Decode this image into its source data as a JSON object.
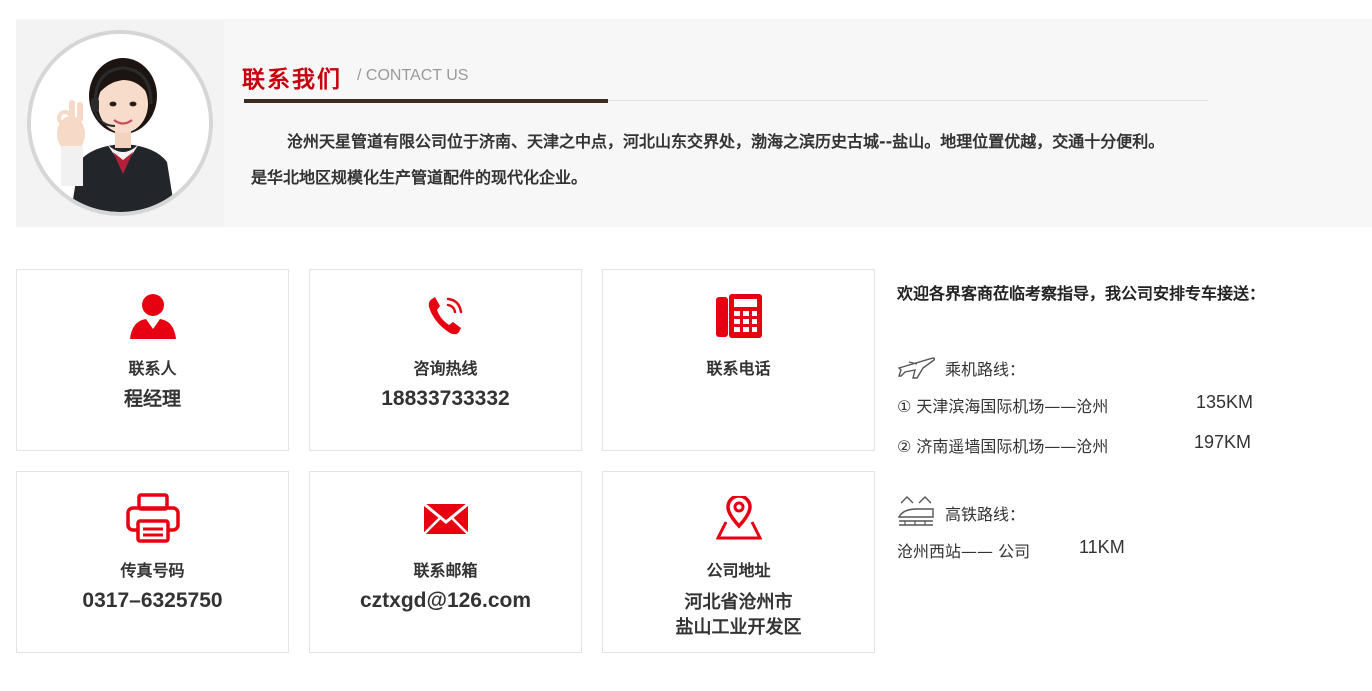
{
  "header": {
    "title_cn": "联系我们",
    "title_en": "/ CONTACT US",
    "intro_line1": "沧州天星管道有限公司位于济南、天津之中点，河北山东交界处，渤海之滨历史古城--盐山。地理位置优越，交通十分便利。",
    "intro_line2": "是华北地区规模化生产管道配件的现代化企业。",
    "avatar_icon": "customer-service-avatar"
  },
  "cards": [
    {
      "icon": "person-icon",
      "label": "联系人",
      "value": "程经理"
    },
    {
      "icon": "phone-call-icon",
      "label": "咨询热线",
      "value": "18833733332"
    },
    {
      "icon": "telephone-icon",
      "label": "联系电话",
      "value": ""
    },
    {
      "icon": "fax-printer-icon",
      "label": "传真号码",
      "value": "0317–6325750"
    },
    {
      "icon": "envelope-icon",
      "label": "联系邮箱",
      "value": "cztxgd@126.com"
    },
    {
      "icon": "map-pin-icon",
      "label": "公司地址",
      "value_line1": "河北省沧州市",
      "value_line2": "盐山工业开发区"
    }
  ],
  "routes": {
    "welcome": "欢迎各界客商莅临考察指导，我公司安排专车接送：",
    "air_heading": "乘机路线：",
    "air": [
      {
        "route": "① 天津滨海国际机场——沧州",
        "distance": "135KM"
      },
      {
        "route": "② 济南遥墙国际机场——沧州",
        "distance": "197KM"
      }
    ],
    "rail_heading": "高铁路线：",
    "rail": [
      {
        "route": "沧州西站—— 公司",
        "distance": "11KM"
      }
    ]
  },
  "colors": {
    "accent": "#e60012",
    "title_red": "#c8000d",
    "rule_dark": "#3a2e24"
  }
}
